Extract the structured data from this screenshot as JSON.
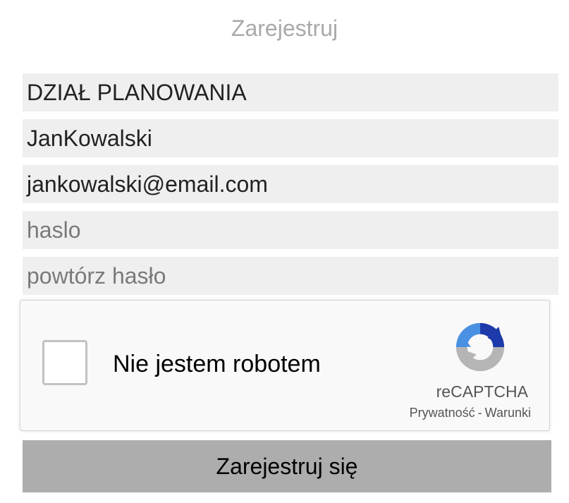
{
  "form": {
    "title": "Zarejestruj",
    "fields": [
      {
        "value": "DZIAŁ PLANOWANIA",
        "placeholder": ""
      },
      {
        "value": "JanKowalski",
        "placeholder": ""
      },
      {
        "value": "jankowalski@email.com",
        "placeholder": ""
      },
      {
        "value": "",
        "placeholder": "haslo"
      },
      {
        "value": "",
        "placeholder": "powtórz hasło"
      }
    ],
    "submit_label": "Zarejestruj się"
  },
  "captcha": {
    "label": "Nie jestem robotem",
    "brand": "reCAPTCHA",
    "privacy_link": "Prywatność",
    "separator": "-",
    "terms_link": "Warunki",
    "checked": false,
    "logo_icon": "recaptcha-logo-icon",
    "colors": {
      "blue_dark": "#1c3aa9",
      "blue_light": "#4a90e2",
      "grey": "#b5b5b5"
    }
  }
}
